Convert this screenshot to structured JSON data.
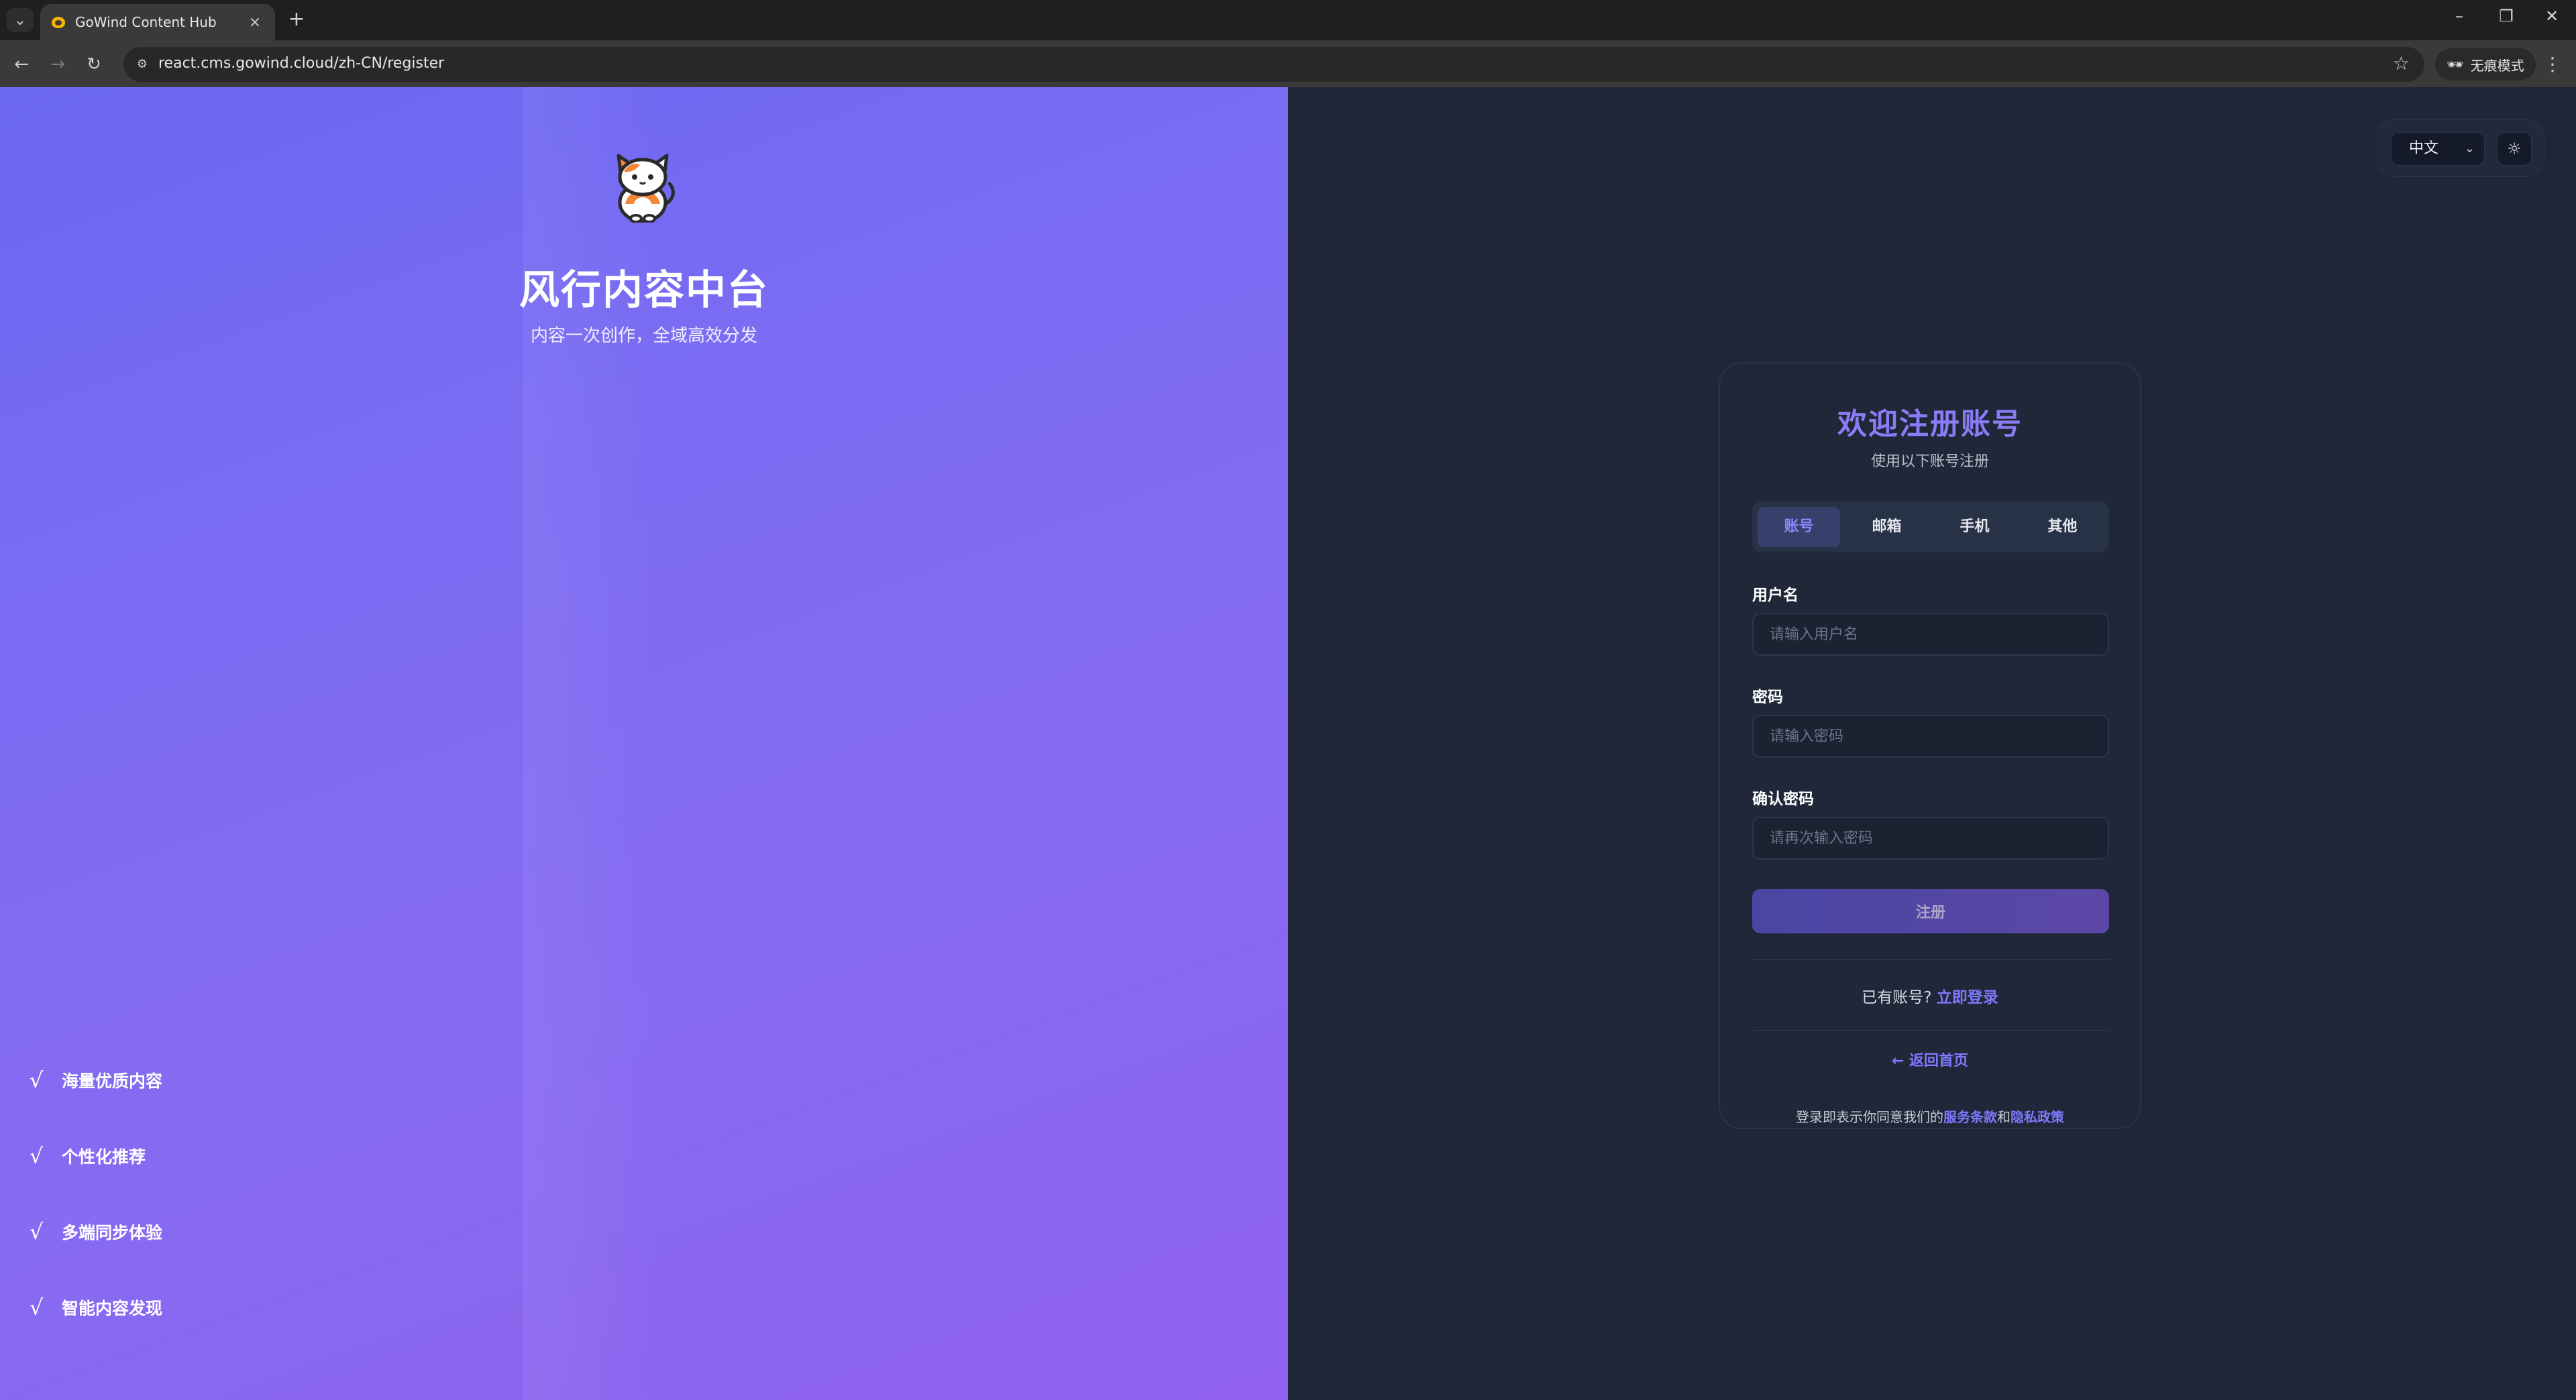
{
  "browser": {
    "tab_title": "GoWind Content Hub",
    "new_tab": "+",
    "close_tab": "×",
    "url": "react.cms.gowind.cloud/zh-CN/register",
    "incognito_label": "无痕模式"
  },
  "hero": {
    "title": "风行内容中台",
    "subtitle": "内容一次创作，全域高效分发",
    "features": [
      {
        "check": "√",
        "label": "海量优质内容"
      },
      {
        "check": "√",
        "label": "个性化推荐"
      },
      {
        "check": "√",
        "label": "多端同步体验"
      },
      {
        "check": "√",
        "label": "智能内容发现"
      }
    ],
    "colors": {
      "gradient_start": "#6a67f1",
      "gradient_end": "#9061ee"
    }
  },
  "controls": {
    "language": "中文",
    "theme_icon": "sun-icon"
  },
  "register": {
    "title": "欢迎注册账号",
    "subtitle": "使用以下账号注册",
    "tabs": [
      {
        "label": "账号",
        "active": true
      },
      {
        "label": "邮箱",
        "active": false
      },
      {
        "label": "手机",
        "active": false
      },
      {
        "label": "其他",
        "active": false
      }
    ],
    "username_label": "用户名",
    "username_placeholder": "请输入用户名",
    "password_label": "密码",
    "password_placeholder": "请输入密码",
    "confirm_label": "确认密码",
    "confirm_placeholder": "请再次输入密码",
    "submit_label": "注册",
    "have_account": "已有账号?",
    "login_now": "立即登录",
    "back_home": "← 返回首页",
    "terms_prefix": "登录即表示你同意我们的",
    "terms_of_service": "服务条款",
    "terms_and": "和",
    "privacy_policy": "隐私政策",
    "accent_color": "#8b7cf6"
  }
}
